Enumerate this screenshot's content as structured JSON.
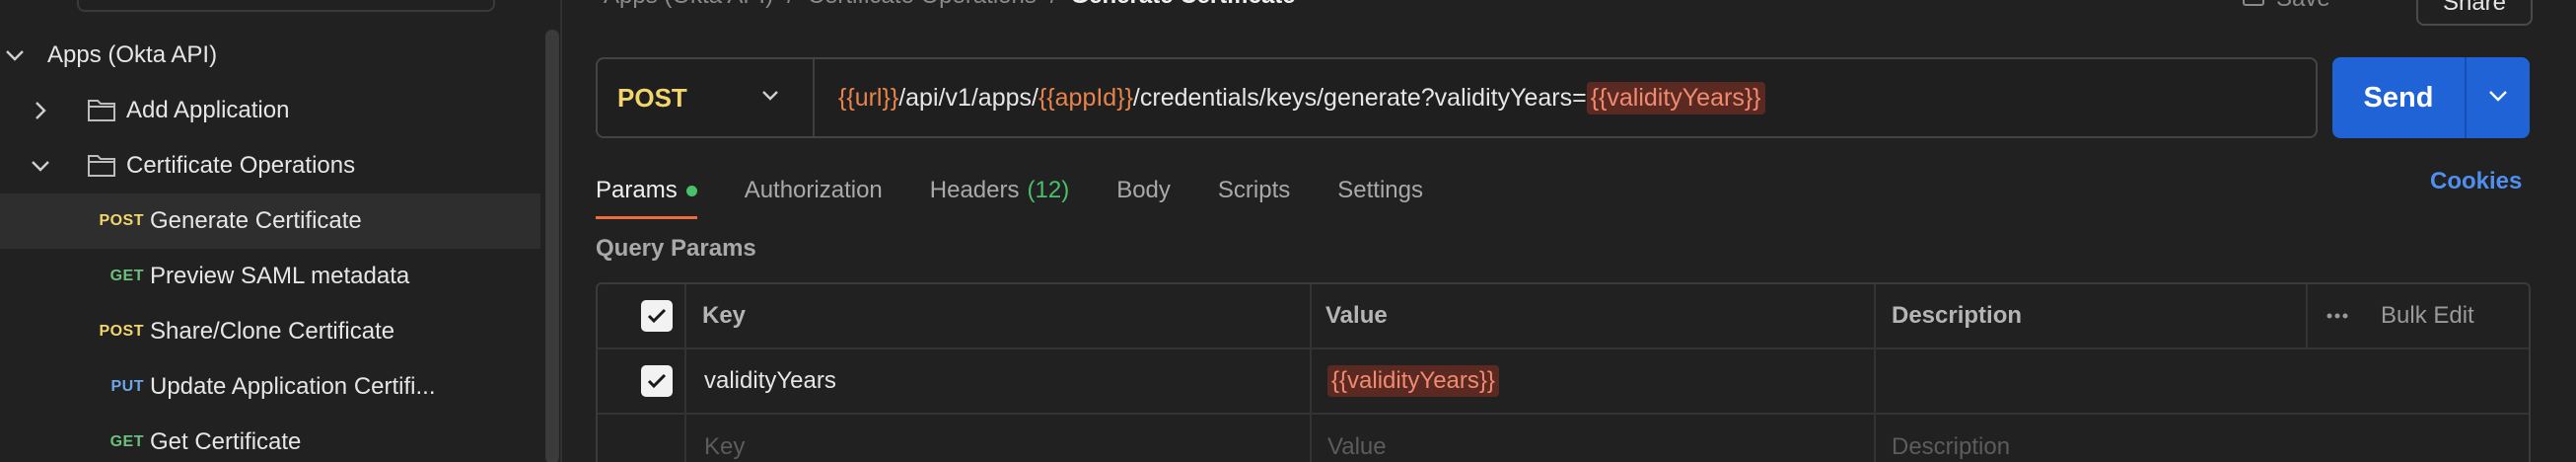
{
  "sidebar": {
    "collection": {
      "label": "Apps (Okta API)"
    },
    "items": [
      {
        "label": "Add Application"
      },
      {
        "label": "Certificate Operations"
      }
    ],
    "requests": [
      {
        "method": "POST",
        "label": "Generate Certificate"
      },
      {
        "method": "GET",
        "label": "Preview SAML metadata"
      },
      {
        "method": "POST",
        "label": "Share/Clone Certificate"
      },
      {
        "method": "PUT",
        "label": "Update Application Certifi..."
      },
      {
        "method": "GET",
        "label": "Get Certificate"
      }
    ]
  },
  "header": {
    "breadcrumb": [
      "Apps (Okta API)",
      "/",
      "Certificate Operations",
      "/",
      "Generate Certificate"
    ],
    "save_label": "Save",
    "share_label": "Share"
  },
  "request": {
    "method": "POST",
    "url_parts": {
      "p1": "{{url}}",
      "p2": "/api/v1/apps/",
      "p3": "{{appId}}",
      "p4": "/credentials/keys/generate?validityYears=",
      "p5": "{{validityYears}}"
    },
    "send_label": "Send"
  },
  "tabs": {
    "params": "Params",
    "authorization": "Authorization",
    "headers": "Headers",
    "headers_count": "(12)",
    "body": "Body",
    "scripts": "Scripts",
    "settings": "Settings",
    "cookies": "Cookies"
  },
  "query_params": {
    "title": "Query Params",
    "columns": {
      "key": "Key",
      "value": "Value",
      "description": "Description",
      "bulk_edit": "Bulk Edit"
    },
    "rows": [
      {
        "key": "validityYears",
        "value": "{{validityYears}}",
        "description": ""
      }
    ],
    "placeholders": {
      "key": "Key",
      "value": "Value",
      "description": "Description"
    }
  },
  "colors": {
    "accent_tab": "#f26b3a",
    "send_button": "#1f63d6",
    "post": "#f2d56b",
    "get": "#6cc07c",
    "put": "#6ea6e8",
    "variable": "#e8834a"
  }
}
